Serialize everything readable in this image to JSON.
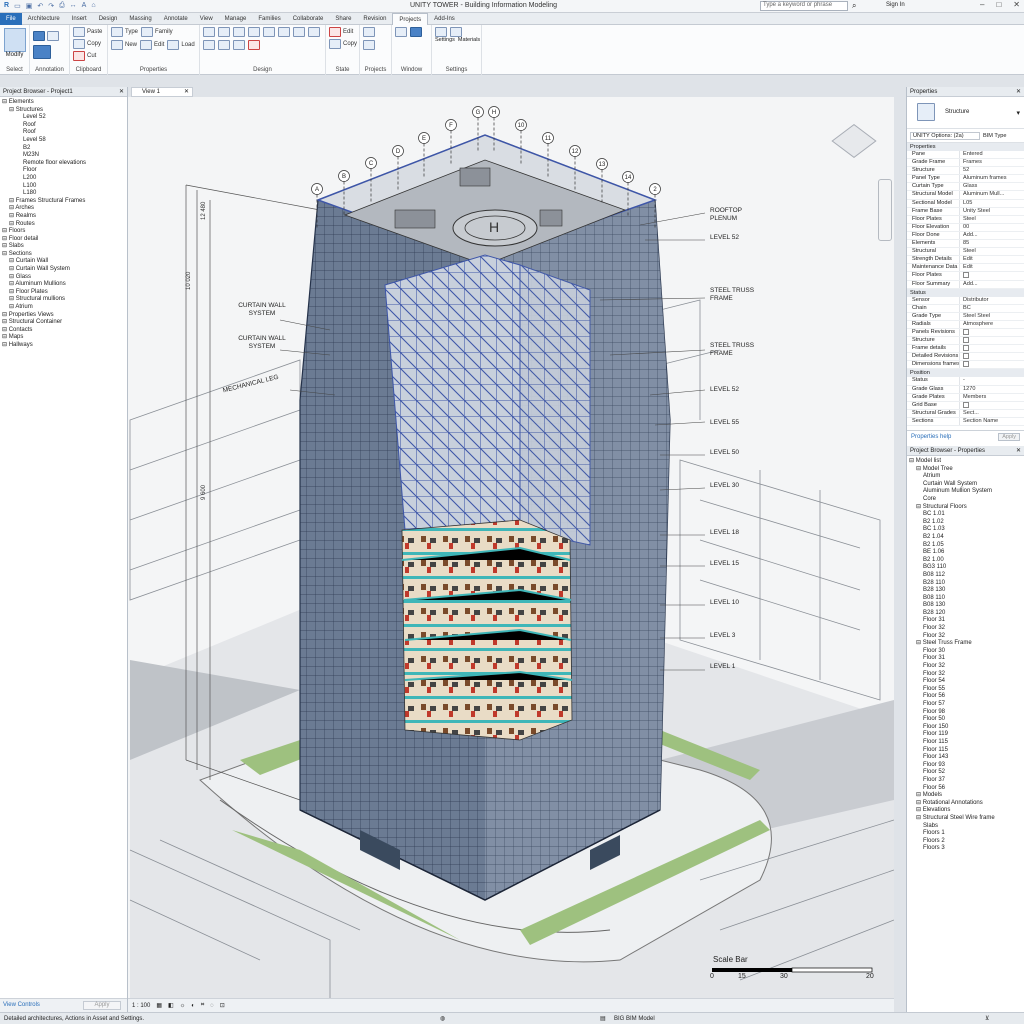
{
  "app": {
    "title": "UNITY TOWER - Building Information Modeling",
    "search_placeholder": "Type a keyword or phrase",
    "user": "Sign In"
  },
  "ribbon_tabs": [
    "File",
    "Architecture",
    "Insert",
    "Design",
    "Massing",
    "Annotate",
    "View",
    "Manage",
    "Families",
    "Collaborate",
    "Share",
    "Revision",
    "Projects",
    "Add-Ins"
  ],
  "ribbon_panels": [
    {
      "label": "Select",
      "items": [
        "Modify"
      ]
    },
    {
      "label": "Annotation",
      "items": []
    },
    {
      "label": "Clipboard",
      "items": [
        "Paste",
        "Copy",
        "Cut"
      ]
    },
    {
      "label": "Properties",
      "items": [
        "Type",
        "Family",
        "New",
        "Edit",
        "Load"
      ]
    },
    {
      "label": "Design",
      "items": []
    },
    {
      "label": "State",
      "items": [
        "Edit",
        "Copy"
      ]
    },
    {
      "label": "Projects",
      "items": []
    },
    {
      "label": "Window",
      "items": []
    },
    {
      "label": "Settings",
      "items": [
        "Settings",
        "Materials"
      ]
    }
  ],
  "project_browser": {
    "title": "Project Browser - Project1",
    "items": [
      {
        "t": "Elements",
        "d": 0
      },
      {
        "t": "Structures",
        "d": 1
      },
      {
        "t": "Level 52",
        "d": 3
      },
      {
        "t": "Roof",
        "d": 3
      },
      {
        "t": "Roof",
        "d": 3
      },
      {
        "t": "Level 58",
        "d": 3
      },
      {
        "t": "B2",
        "d": 3
      },
      {
        "t": "M23N",
        "d": 3
      },
      {
        "t": "Remote floor elevations",
        "d": 3
      },
      {
        "t": "Floor",
        "d": 3
      },
      {
        "t": "L200",
        "d": 3
      },
      {
        "t": "L100",
        "d": 3
      },
      {
        "t": "L180",
        "d": 3
      },
      {
        "t": "Frames Structural Frames",
        "d": 1
      },
      {
        "t": "Arches",
        "d": 1
      },
      {
        "t": "Realms",
        "d": 1
      },
      {
        "t": "Routes",
        "d": 1
      },
      {
        "t": "Floors",
        "d": 0
      },
      {
        "t": "Floor detail",
        "d": 0
      },
      {
        "t": "Slabs",
        "d": 0
      },
      {
        "t": "Sections",
        "d": 0
      },
      {
        "t": "Curtain Wall",
        "d": 1
      },
      {
        "t": "Curtain Wall System",
        "d": 1
      },
      {
        "t": "Glass",
        "d": 1
      },
      {
        "t": "Aluminum Mullions",
        "d": 1
      },
      {
        "t": "Floor Plates",
        "d": 1
      },
      {
        "t": "Structural mullions",
        "d": 1
      },
      {
        "t": "Atrium",
        "d": 1
      },
      {
        "t": "Properties Views",
        "d": 0
      },
      {
        "t": "Structural Container",
        "d": 0
      },
      {
        "t": "Contacts",
        "d": 0
      },
      {
        "t": "Maps",
        "d": 0
      },
      {
        "t": "Hallways",
        "d": 0
      }
    ],
    "footer_link": "View Controls",
    "footer_apply": "Apply"
  },
  "view": {
    "tab": "View 1",
    "scale_label": "1 : 100",
    "grid_bubbles_top": [
      "A",
      "B",
      "C",
      "D",
      "E",
      "F",
      "G",
      "H",
      "10",
      "11",
      "12",
      "13",
      "14",
      "2"
    ],
    "annotations_left": [
      "CURTAIN WALL SYSTEM",
      "CURTAIN WALL SYSTEM",
      "MECHANICAL LEG"
    ],
    "annotations_right": [
      {
        "label": "ROOFTOP PLENUM"
      },
      {
        "label": "LEVEL 52"
      },
      {
        "label": "STEEL TRUSS FRAME"
      },
      {
        "label": "STEEL TRUSS FRAME"
      },
      {
        "label": "LEVEL 52"
      },
      {
        "label": "LEVEL 55"
      },
      {
        "label": "LEVEL 50"
      },
      {
        "label": "LEVEL 30"
      },
      {
        "label": "LEVEL 18"
      },
      {
        "label": "LEVEL 15"
      },
      {
        "label": "LEVEL 10"
      },
      {
        "label": "LEVEL 3"
      },
      {
        "label": "LEVEL 1"
      }
    ],
    "scale_bar": {
      "title": "Scale Bar",
      "ticks": [
        "0",
        "15",
        "30",
        "20"
      ]
    }
  },
  "properties": {
    "title": "Properties",
    "family": "Structure",
    "type_selector": "UNITY Options: (2a)",
    "edit_type": "BIM Type",
    "sections": [
      {
        "name": "Properties",
        "rows": [
          [
            "Pane",
            "Entered"
          ],
          [
            "Grade Frame",
            "Frames"
          ],
          [
            "Structure",
            "52"
          ],
          [
            "Panel Type",
            "Aluminum frames"
          ],
          [
            "Curtain Type",
            "Glass"
          ],
          [
            "Structural Model",
            "Aluminum Mull..."
          ],
          [
            "Sectional Model",
            "L05"
          ],
          [
            "Frame Base",
            "Unity Steel"
          ],
          [
            "Floor Plates",
            "Steel"
          ],
          [
            "Floor Elevation",
            "00"
          ],
          [
            "Floor Done",
            "Add..."
          ],
          [
            "Elements",
            "85"
          ],
          [
            "Structural",
            "Steel"
          ],
          [
            "Strength Details",
            "Edit"
          ],
          [
            "Maintenance Data",
            "Edit"
          ],
          [
            "Floor Plates",
            ""
          ],
          [
            "Floor Summary",
            "Add..."
          ]
        ]
      },
      {
        "name": "Status",
        "rows": [
          [
            "Sensor",
            "Distributor"
          ],
          [
            "Chain",
            "BC"
          ],
          [
            "Grade Type",
            "Steel Steel"
          ],
          [
            "Radials",
            "Atmosphere"
          ],
          [
            "Panels Revisions",
            ""
          ],
          [
            "Structure",
            ""
          ],
          [
            "Frame details",
            ""
          ],
          [
            "Detailed Revisions",
            ""
          ],
          [
            "Dimensions frames",
            ""
          ]
        ]
      },
      {
        "name": "Position",
        "rows": [
          [
            "Status",
            "-"
          ],
          [
            "Grade Glass",
            "1270"
          ],
          [
            "Grade Plates",
            "Members"
          ],
          [
            "Grid Base",
            ""
          ],
          [
            "Structural Grades",
            "Sect..."
          ],
          [
            "Sections",
            "Section Name"
          ]
        ]
      }
    ],
    "help_link": "Properties help",
    "apply": "Apply"
  },
  "browser2": {
    "title": "Project Browser - Properties",
    "items": [
      {
        "t": "Model list",
        "d": 0
      },
      {
        "t": "Model Tree",
        "d": 1
      },
      {
        "t": "Atrium",
        "d": 2
      },
      {
        "t": "Curtain Wall System",
        "d": 2
      },
      {
        "t": "Aluminum Mullion System",
        "d": 2
      },
      {
        "t": "Core",
        "d": 2
      },
      {
        "t": "Structural Floors",
        "d": 1
      },
      {
        "t": "BC 1.01",
        "d": 2
      },
      {
        "t": "B2 1.02",
        "d": 2
      },
      {
        "t": "BC 1.03",
        "d": 2
      },
      {
        "t": "B2 1.04",
        "d": 2
      },
      {
        "t": "B2 1.05",
        "d": 2
      },
      {
        "t": "BE 1.06",
        "d": 2
      },
      {
        "t": "B2 1.00",
        "d": 2
      },
      {
        "t": "BG3 110",
        "d": 2
      },
      {
        "t": "B08 112",
        "d": 2
      },
      {
        "t": "B28 110",
        "d": 2
      },
      {
        "t": "B28 130",
        "d": 2
      },
      {
        "t": "B08 110",
        "d": 2
      },
      {
        "t": "B08 130",
        "d": 2
      },
      {
        "t": "B28 120",
        "d": 2
      },
      {
        "t": "Floor 31",
        "d": 2
      },
      {
        "t": "Floor 32",
        "d": 2
      },
      {
        "t": "Floor 32",
        "d": 2
      },
      {
        "t": "Steel Truss Frame",
        "d": 1
      },
      {
        "t": "Floor 30",
        "d": 2
      },
      {
        "t": "Floor 31",
        "d": 2
      },
      {
        "t": "Floor 32",
        "d": 2
      },
      {
        "t": "Floor 32",
        "d": 2
      },
      {
        "t": "Floor 54",
        "d": 2
      },
      {
        "t": "Floor 55",
        "d": 2
      },
      {
        "t": "Floor 56",
        "d": 2
      },
      {
        "t": "Floor 57",
        "d": 2
      },
      {
        "t": "Floor 98",
        "d": 2
      },
      {
        "t": "Floor 50",
        "d": 2
      },
      {
        "t": "Floor 150",
        "d": 2
      },
      {
        "t": "Floor 119",
        "d": 2
      },
      {
        "t": "Floor 115",
        "d": 2
      },
      {
        "t": "Floor 115",
        "d": 2
      },
      {
        "t": "Floor 143",
        "d": 2
      },
      {
        "t": "Floor 93",
        "d": 2
      },
      {
        "t": "Floor 52",
        "d": 2
      },
      {
        "t": "Floor 37",
        "d": 2
      },
      {
        "t": "Floor 56",
        "d": 2
      },
      {
        "t": "Models",
        "d": 1
      },
      {
        "t": "Rotational Annotations",
        "d": 1
      },
      {
        "t": "Elevations",
        "d": 1
      },
      {
        "t": "Structural Steel Wire frame",
        "d": 1
      },
      {
        "t": "Slabs",
        "d": 2
      },
      {
        "t": "Floors 1",
        "d": 2
      },
      {
        "t": "Floors 2",
        "d": 2
      },
      {
        "t": "Floors 3",
        "d": 2
      }
    ]
  },
  "status": {
    "text": "Detailed architectures, Actions in Asset and Settings.",
    "model": "BIG BIM Model"
  },
  "colors": {
    "accent": "#2a6fba",
    "glass": "#5d6f88",
    "frame": "#3e56a8",
    "interior_teal": "#3fb6b8",
    "landscape": "#9ec17f"
  }
}
